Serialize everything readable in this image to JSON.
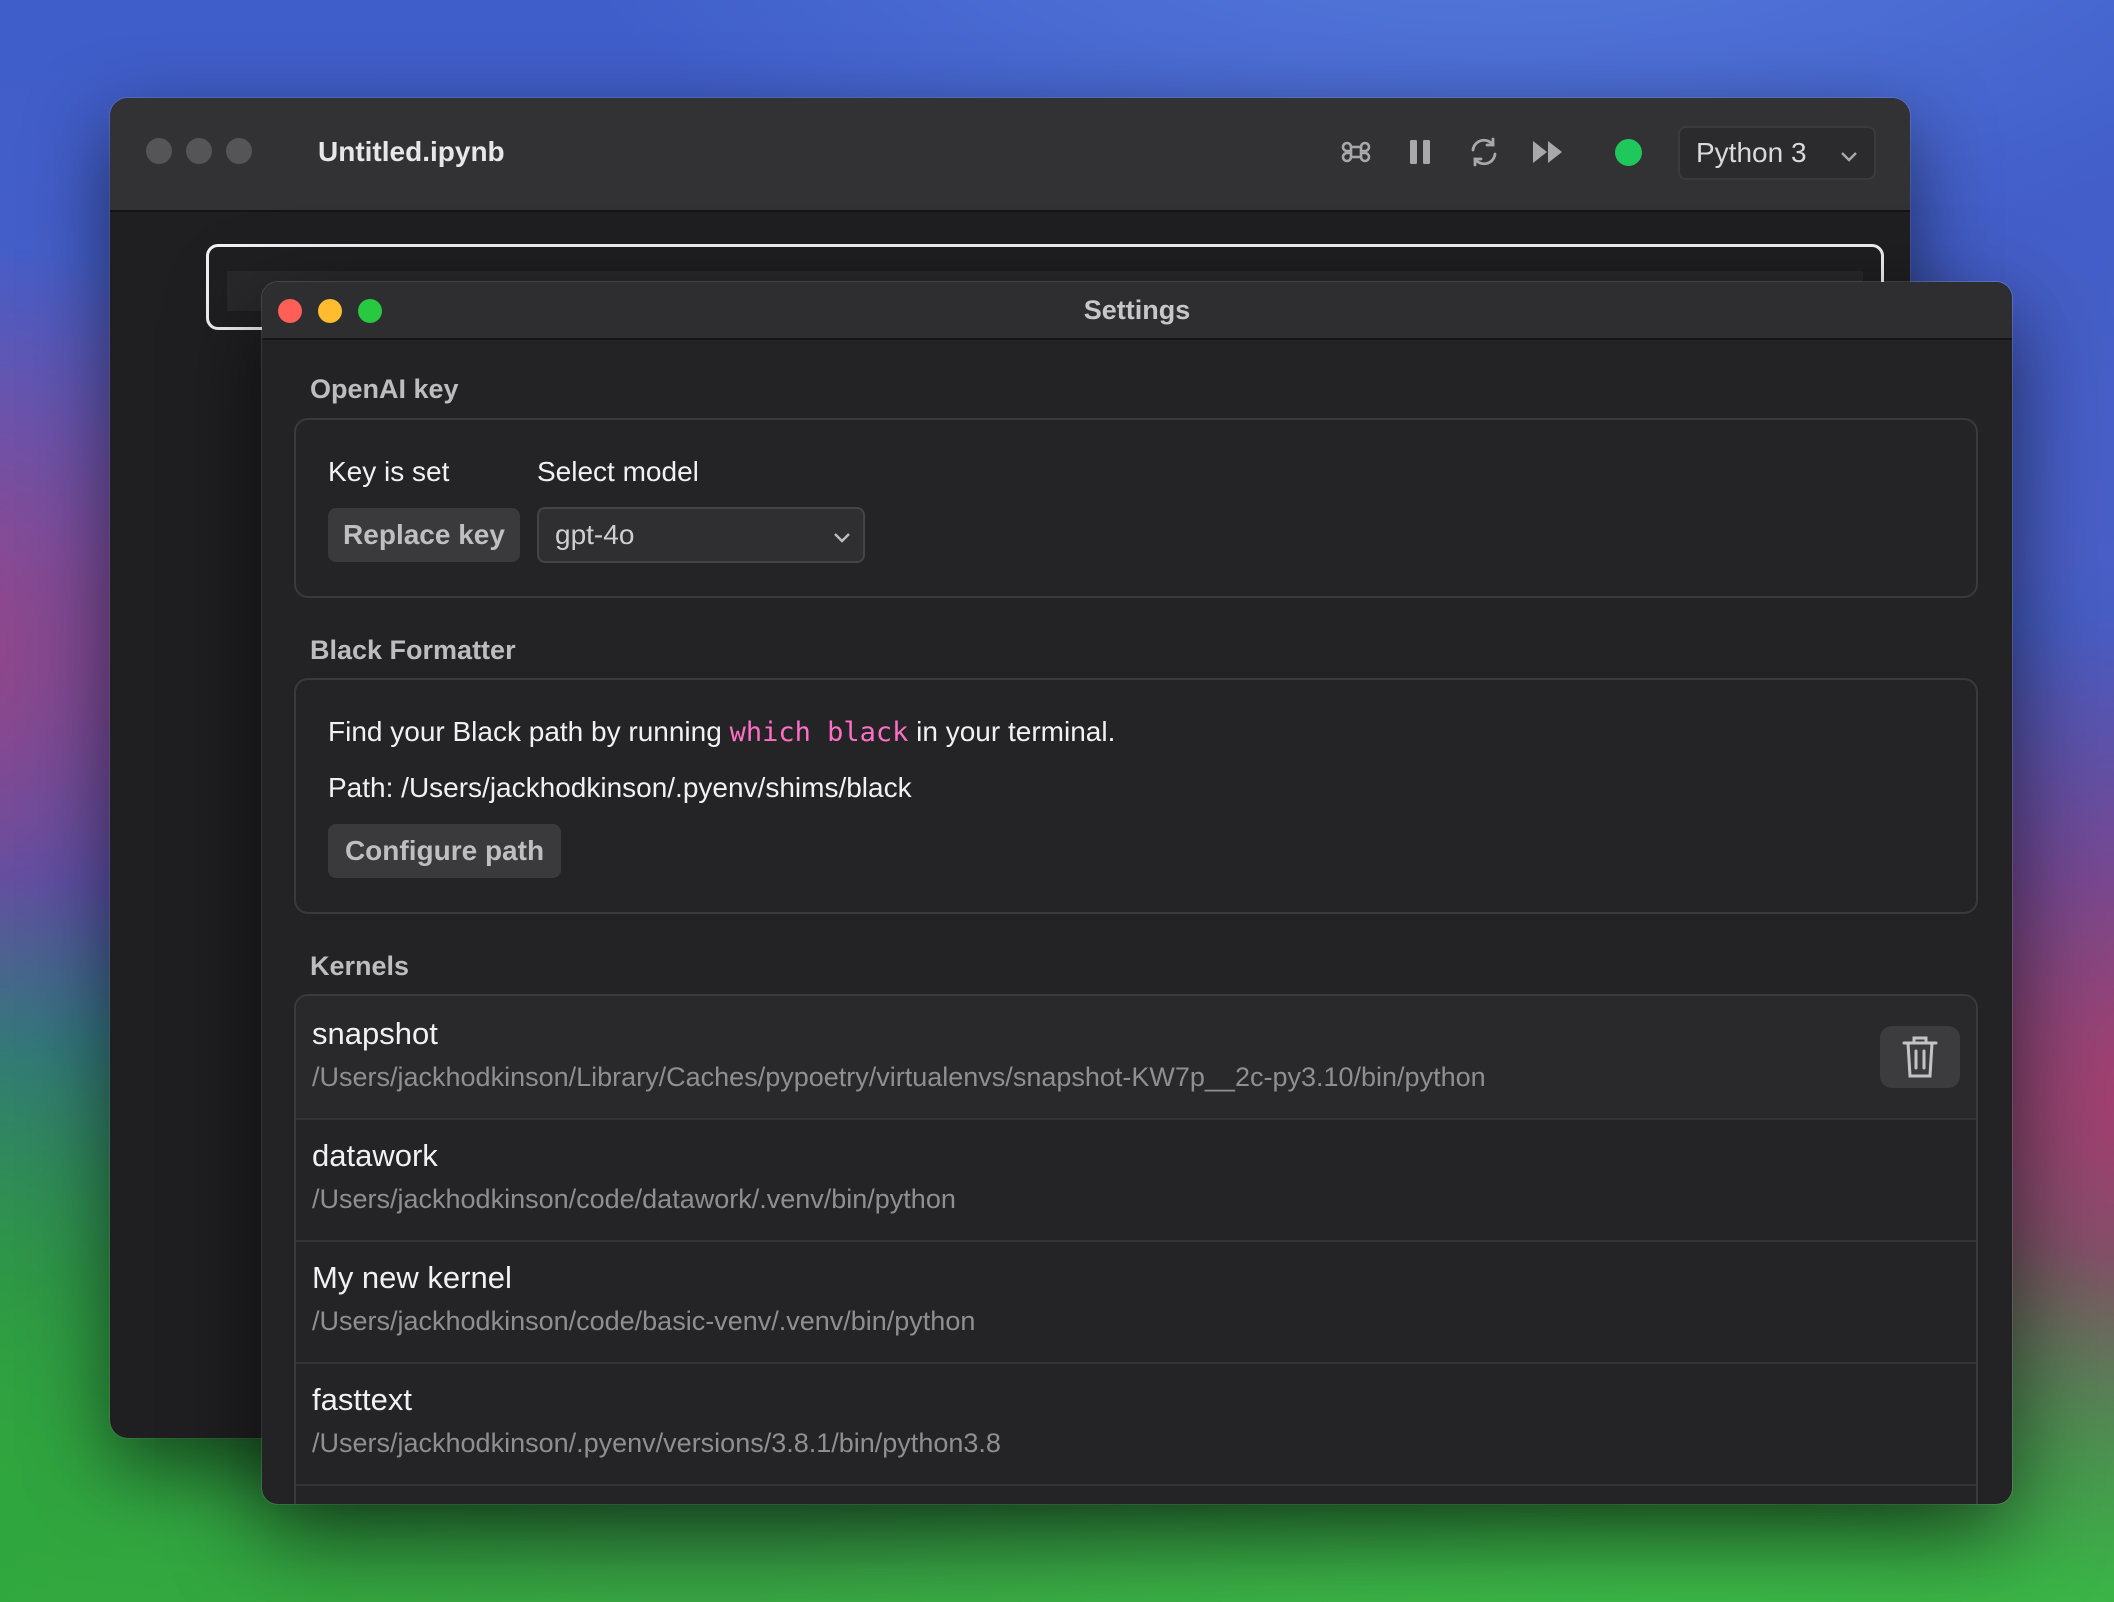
{
  "notebook": {
    "title": "Untitled.ipynb",
    "toolbar": {
      "command_icon": "command-icon",
      "pause_icon": "pause-icon",
      "restart_icon": "restart-icon",
      "run_all_icon": "run-all-icon",
      "kernel_status_color": "#1fc85a",
      "kernel_name": "Python 3"
    }
  },
  "settings": {
    "title": "Settings",
    "openai": {
      "section_title": "OpenAI key",
      "key_status": "Key is set",
      "replace_key_label": "Replace key",
      "model_label": "Select model",
      "model_value": "gpt-4o"
    },
    "black": {
      "section_title": "Black Formatter",
      "instruction_prefix": "Find your Black path by running",
      "instruction_code": "which black",
      "instruction_suffix": "in your terminal.",
      "path_text": "Path: /Users/jackhodkinson/.pyenv/shims/black",
      "configure_label": "Configure path"
    },
    "kernels": {
      "section_title": "Kernels",
      "items": [
        {
          "name": "snapshot",
          "path": "/Users/jackhodkinson/Library/Caches/pypoetry/virtualenvs/snapshot-KW7p__2c-py3.10/bin/python"
        },
        {
          "name": "datawork",
          "path": "/Users/jackhodkinson/code/datawork/.venv/bin/python"
        },
        {
          "name": "My new kernel",
          "path": "/Users/jackhodkinson/code/basic-venv/.venv/bin/python"
        },
        {
          "name": "fasttext",
          "path": "/Users/jackhodkinson/.pyenv/versions/3.8.1/bin/python3.8"
        }
      ]
    }
  },
  "colors": {
    "accent_code": "#ff6ec7",
    "close": "#ff5f57",
    "minimize": "#febc2e",
    "zoom": "#28c840"
  }
}
